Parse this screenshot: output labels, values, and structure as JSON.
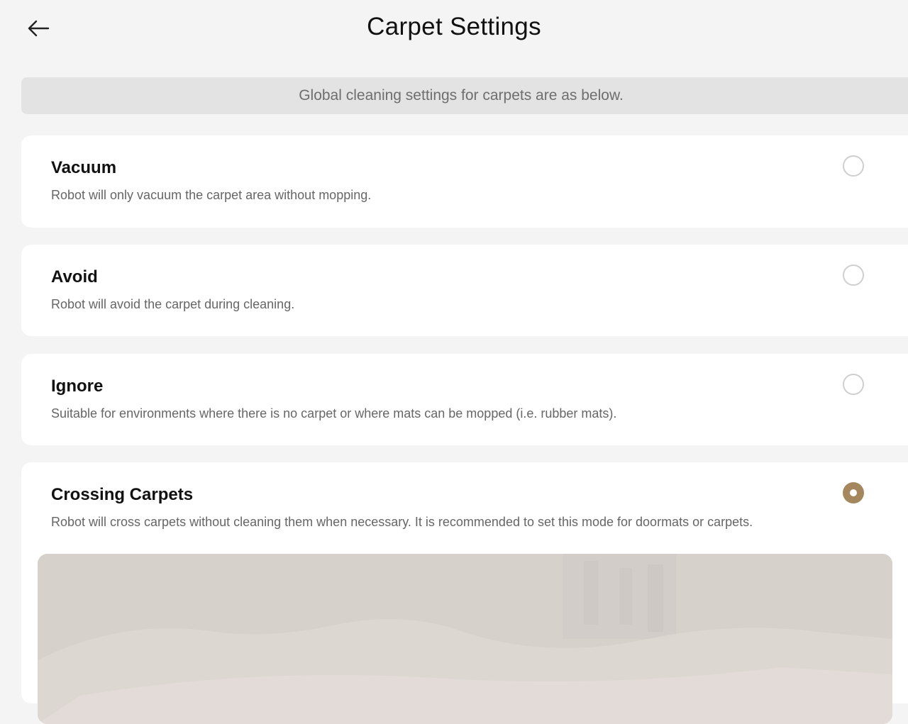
{
  "header": {
    "title": "Carpet Settings",
    "back_icon": "arrow-left-icon"
  },
  "notice": {
    "text": "Global cleaning settings for carpets are as below."
  },
  "options": [
    {
      "id": "vacuum",
      "title": "Vacuum",
      "description": "Robot will only vacuum the carpet area without mopping.",
      "selected": false
    },
    {
      "id": "avoid",
      "title": "Avoid",
      "description": "Robot will avoid the carpet during cleaning.",
      "selected": false
    },
    {
      "id": "ignore",
      "title": "Ignore",
      "description": "Suitable for environments where there is no carpet or where mats can be mopped (i.e. rubber mats).",
      "selected": false
    },
    {
      "id": "crossing",
      "title": "Crossing Carpets",
      "description": "Robot will cross carpets without cleaning them when necessary. It is recommended to set this mode for doormats or carpets.",
      "selected": true
    }
  ],
  "colors": {
    "background": "#f4f4f4",
    "card": "#ffffff",
    "notice_bg": "#e3e3e3",
    "accent": "#a5875e",
    "radio_border": "#cfcfcf"
  }
}
